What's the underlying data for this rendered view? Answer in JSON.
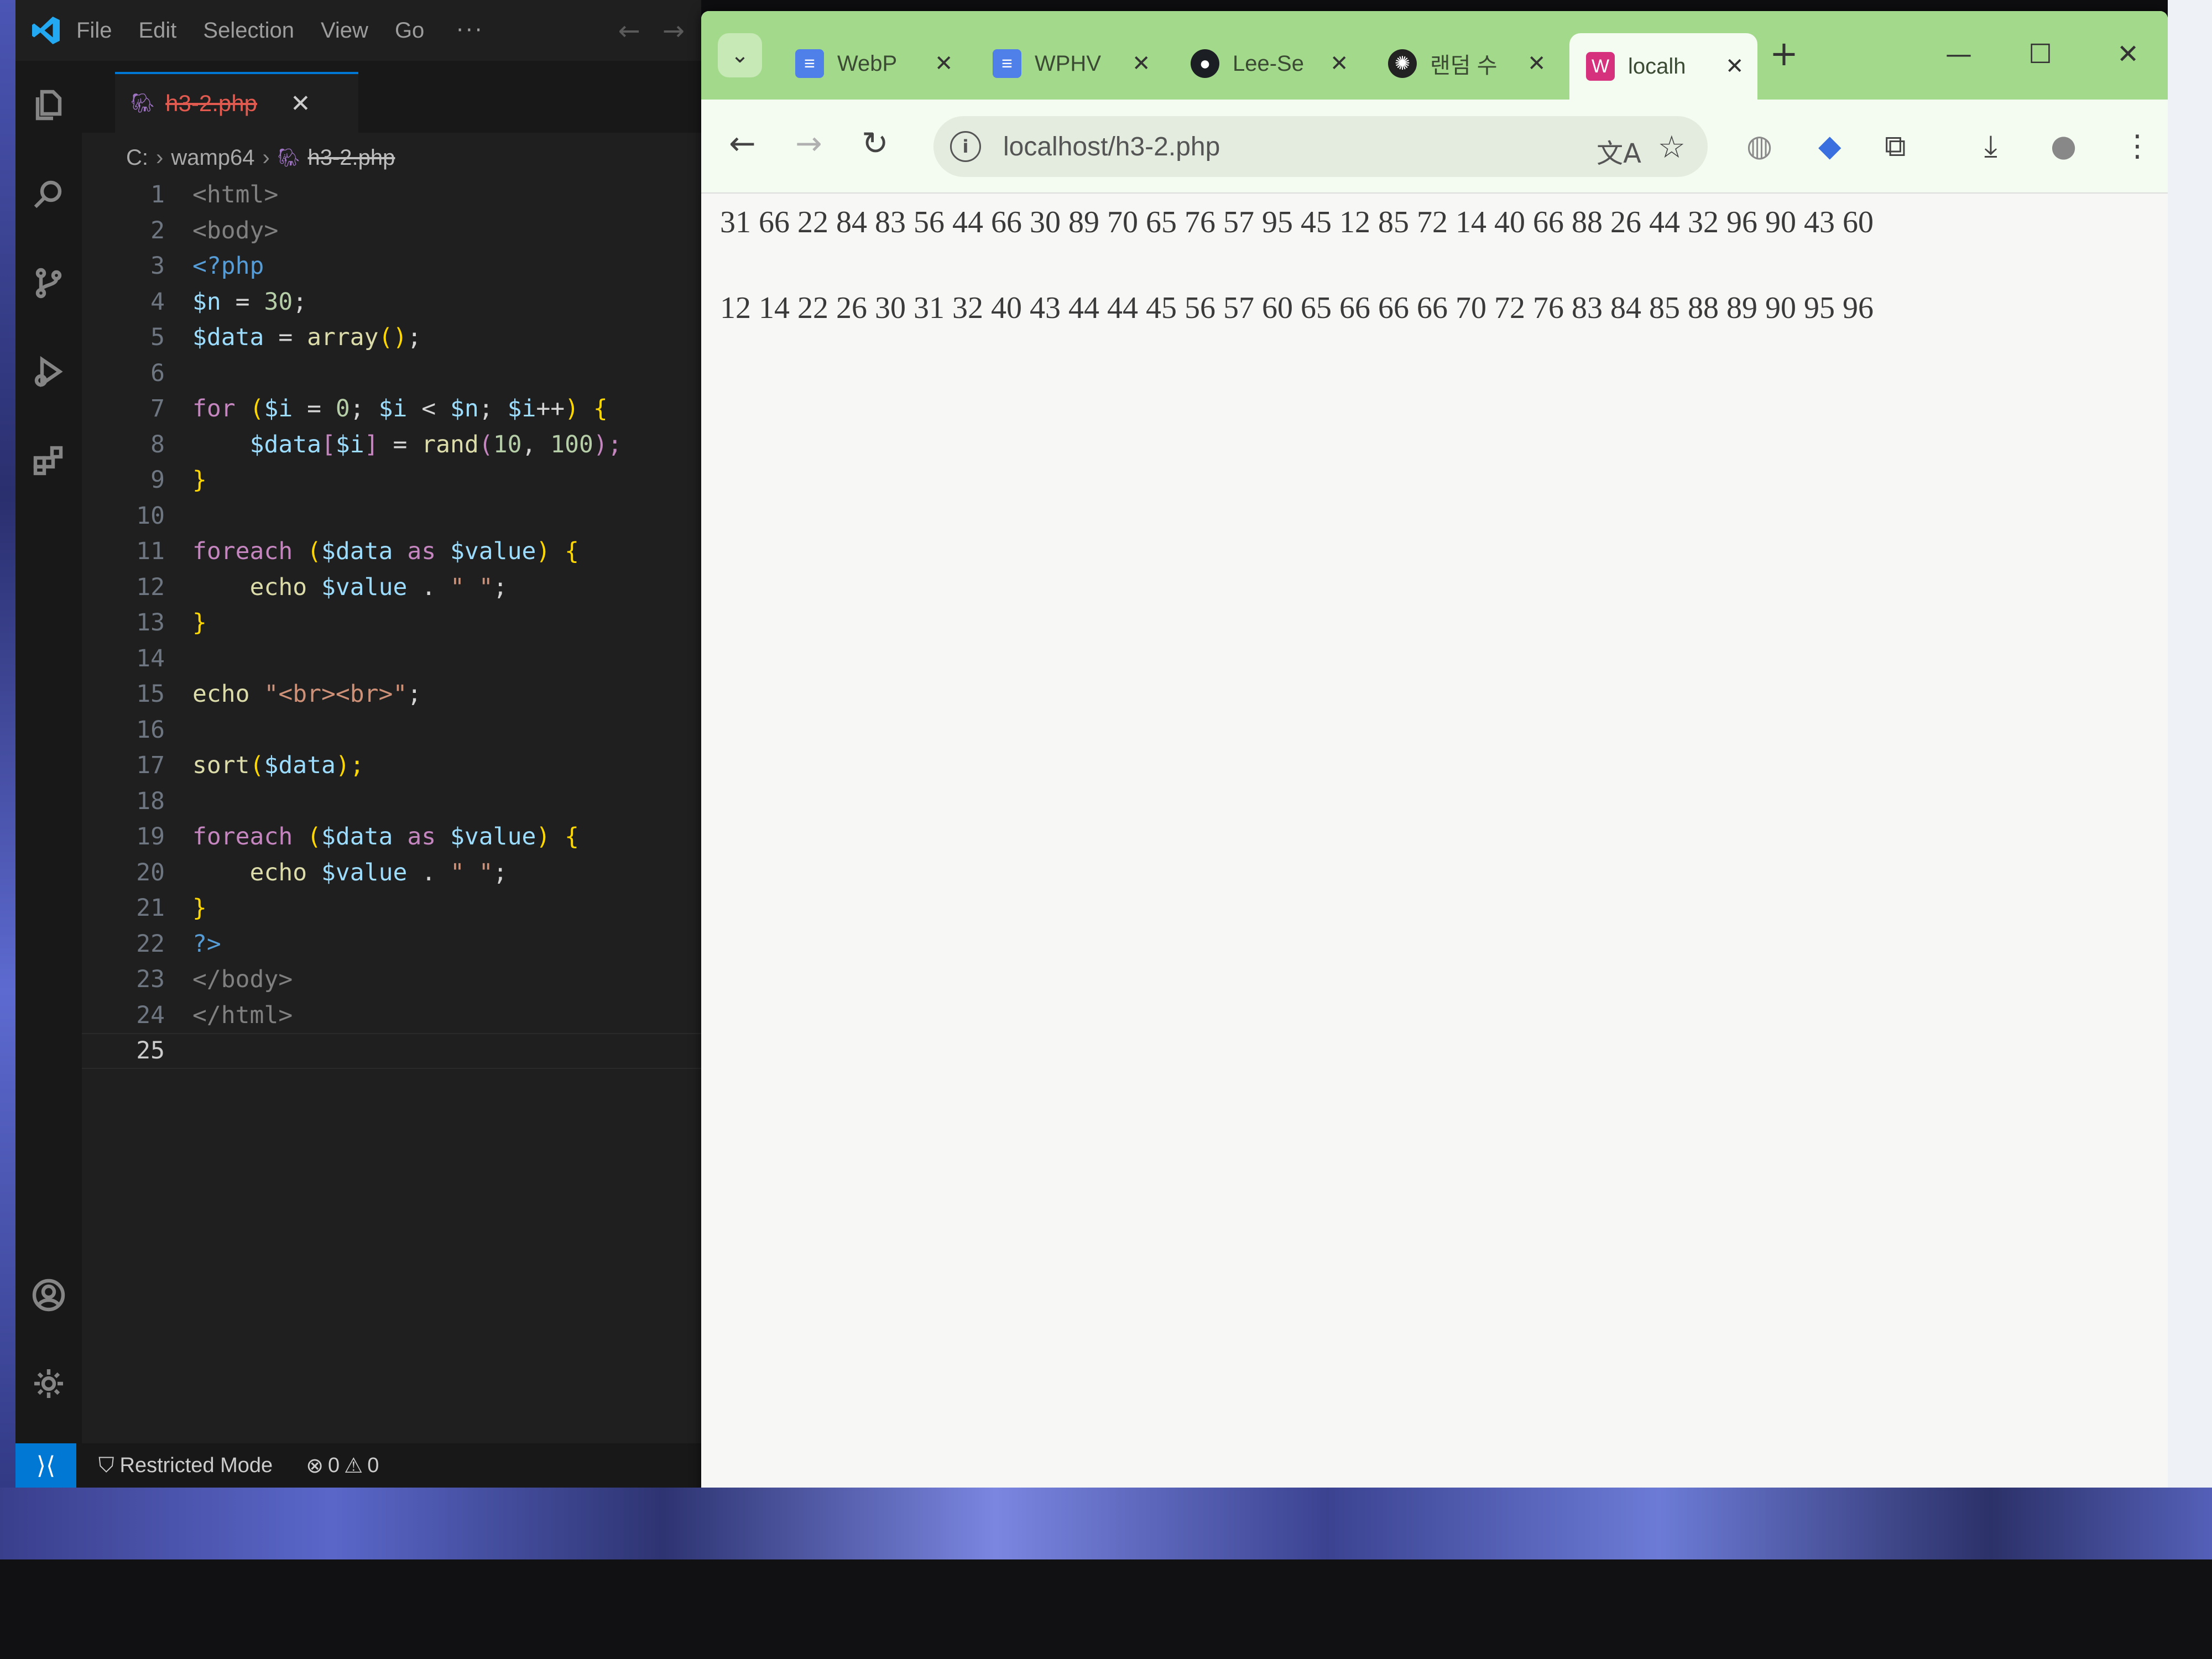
{
  "vscode": {
    "menu": [
      "File",
      "Edit",
      "Selection",
      "View",
      "Go"
    ],
    "menu_more": "···",
    "tab": {
      "label": "h3-2.php",
      "close": "✕"
    },
    "breadcrumb": {
      "drive": "C:",
      "folder": "wamp64",
      "file": "h3-2.php"
    },
    "lines": [
      {
        "n": "1"
      },
      {
        "n": "2"
      },
      {
        "n": "3"
      },
      {
        "n": "4"
      },
      {
        "n": "5"
      },
      {
        "n": "6"
      },
      {
        "n": "7"
      },
      {
        "n": "8"
      },
      {
        "n": "9"
      },
      {
        "n": "10"
      },
      {
        "n": "11"
      },
      {
        "n": "12"
      },
      {
        "n": "13"
      },
      {
        "n": "14"
      },
      {
        "n": "15"
      },
      {
        "n": "16"
      },
      {
        "n": "17"
      },
      {
        "n": "18"
      },
      {
        "n": "19"
      },
      {
        "n": "20"
      },
      {
        "n": "21"
      },
      {
        "n": "22"
      },
      {
        "n": "23"
      },
      {
        "n": "24"
      },
      {
        "n": "25"
      }
    ],
    "code": {
      "l1": "<html>",
      "l2": "<body>",
      "l3": "<?php",
      "l4_var": "$n",
      "l4_eq": " = ",
      "l4_num": "30",
      "l4_end": ";",
      "l5_var": "$data",
      "l5_eq": " = ",
      "l5_fn": "array",
      "l5_paren": "()",
      "l5_end": ";",
      "l7_kw": "for",
      "l7_open": " (",
      "l7_i1": "$i",
      "l7_a": " = ",
      "l7_zero": "0",
      "l7_b": "; ",
      "l7_i2": "$i",
      "l7_c": " < ",
      "l7_n": "$n",
      "l7_d": "; ",
      "l7_i3": "$i",
      "l7_e": "++",
      "l7_close": ") {",
      "l8_var": "$data",
      "l8_br1": "[",
      "l8_i": "$i",
      "l8_br2": "]",
      "l8_eq": " = ",
      "l8_fn": "rand",
      "l8_p1": "(",
      "l8_a": "10",
      "l8_c": ", ",
      "l8_b": "100",
      "l8_p2": ");",
      "l9": "}",
      "l11_kw": "foreach",
      "l11_open": " (",
      "l11_data": "$data",
      "l11_as": " as ",
      "l11_val": "$value",
      "l11_close": ") {",
      "l12_kw": "echo",
      "l12_val": "$value",
      "l12_dot": " . ",
      "l12_str": "\" \"",
      "l12_end": ";",
      "l13": "}",
      "l15_kw": "echo",
      "l15_str": "\"<br><br>\"",
      "l15_end": ";",
      "l17_fn": "sort",
      "l17_p1": "(",
      "l17_var": "$data",
      "l17_p2": ");",
      "l19_kw": "foreach",
      "l19_open": " (",
      "l19_data": "$data",
      "l19_as": " as ",
      "l19_val": "$value",
      "l19_close": ") {",
      "l20_kw": "echo",
      "l20_val": "$value",
      "l20_dot": " . ",
      "l20_str": "\" \"",
      "l20_end": ";",
      "l21": "}",
      "l22": "?>",
      "l23": "</body>",
      "l24": "</html>"
    },
    "status": {
      "restricted": "Restricted Mode",
      "errors": "0",
      "warnings": "0"
    }
  },
  "chrome": {
    "tabs": [
      {
        "title": "WebP",
        "color": "#4f7fe8",
        "icon": "document-icon"
      },
      {
        "title": "WPHV",
        "color": "#4f7fe8",
        "icon": "document-icon"
      },
      {
        "title": "Lee-Se",
        "color": "#1b1f23",
        "icon": "github-icon"
      },
      {
        "title": "랜덤 수",
        "color": "#222222",
        "icon": "chatgpt-icon"
      },
      {
        "title": "localh",
        "color": "#d6317d",
        "icon": "wamp-icon"
      }
    ],
    "url": "localhost/h3-2.php",
    "output": {
      "line1": "31 66 22 84 83 56 44 66 30 89 70 65 76 57 95 45 12 85 72 14 40 66 88 26 44 32 96 90 43 60",
      "line2": "12 14 22 26 30 31 32 40 43 44 44 45 56 57 60 65 66 66 66 70 72 76 83 84 85 88 89 90 95 96"
    }
  }
}
